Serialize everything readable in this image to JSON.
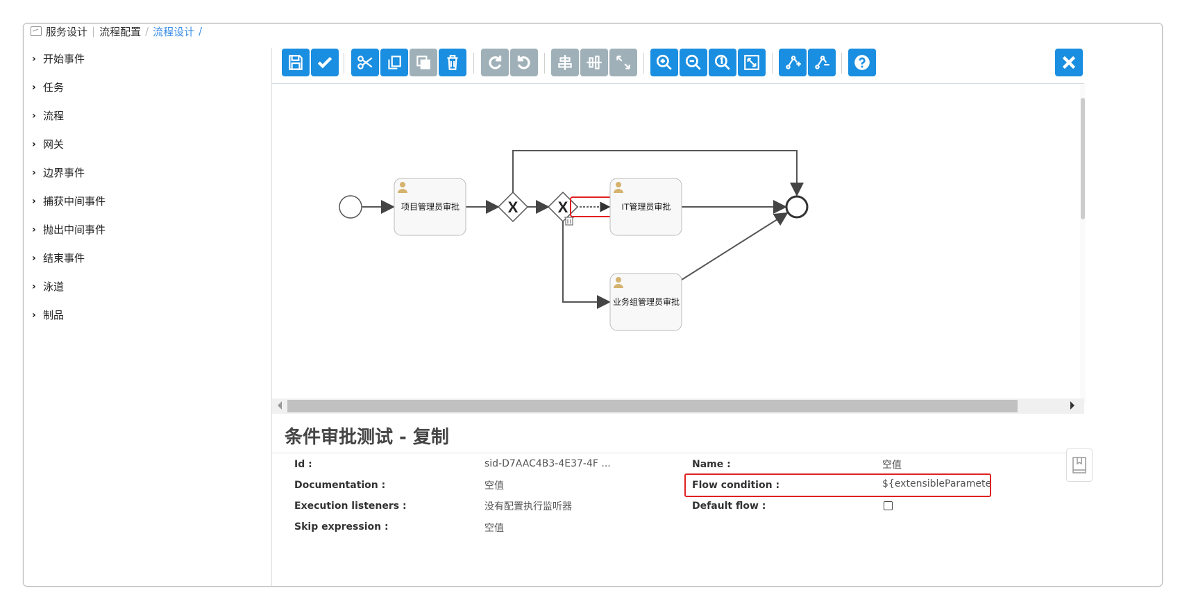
{
  "breadcrumb": {
    "icon": "picture-icon",
    "items": [
      "服务设计",
      "流程配置",
      "流程设计"
    ],
    "separator": "/"
  },
  "palette": {
    "items": [
      "开始事件",
      "任务",
      "流程",
      "网关",
      "边界事件",
      "捕获中间事件",
      "抛出中间事件",
      "结束事件",
      "泳道",
      "制品"
    ]
  },
  "toolbar": {
    "buttons": [
      {
        "name": "save",
        "icon": "save-icon",
        "color": "#1a8ee0"
      },
      {
        "name": "validate",
        "icon": "check-icon",
        "color": "#1a8ee0"
      },
      {
        "name": "cut",
        "icon": "scissors-icon",
        "color": "#1a8ee0"
      },
      {
        "name": "copy",
        "icon": "copy-icon",
        "color": "#1a8ee0"
      },
      {
        "name": "paste",
        "icon": "paste-icon",
        "color": "#9fb0b8"
      },
      {
        "name": "delete",
        "icon": "trash-icon",
        "color": "#1a8ee0"
      },
      {
        "name": "redo",
        "icon": "redo-icon",
        "color": "#9fb0b8"
      },
      {
        "name": "undo",
        "icon": "undo-icon",
        "color": "#9fb0b8"
      },
      {
        "name": "align-horizontal",
        "icon": "align-horizontal-icon",
        "color": "#9fb0b8"
      },
      {
        "name": "align-vertical",
        "icon": "align-vertical-icon",
        "color": "#9fb0b8"
      },
      {
        "name": "same-size",
        "icon": "same-size-icon",
        "color": "#9fb0b8"
      },
      {
        "name": "zoom-in",
        "icon": "zoom-in-icon",
        "color": "#1a8ee0"
      },
      {
        "name": "zoom-out",
        "icon": "zoom-out-icon",
        "color": "#1a8ee0"
      },
      {
        "name": "zoom-actual",
        "icon": "zoom-actual-icon",
        "color": "#1a8ee0"
      },
      {
        "name": "zoom-fit",
        "icon": "zoom-fit-icon",
        "color": "#1a8ee0"
      },
      {
        "name": "add-bendpoint",
        "icon": "add-bendpoint-icon",
        "color": "#1a8ee0"
      },
      {
        "name": "remove-bendpoint",
        "icon": "remove-bendpoint-icon",
        "color": "#1a8ee0"
      },
      {
        "name": "help",
        "icon": "help-icon",
        "color": "#1a8ee0"
      },
      {
        "name": "close",
        "icon": "close-icon",
        "color": "#1a8ee0"
      }
    ]
  },
  "diagram": {
    "tasks": [
      "项目管理员审批",
      "IT管理员审批",
      "业务组管理员审批"
    ],
    "gateway_symbol": "X"
  },
  "properties": {
    "title": "条件审批测试 - 复制",
    "left": [
      {
        "label": "Id :",
        "value": "sid-D7AAC4B3-4E37-4F ..."
      },
      {
        "label": "Documentation :",
        "value": "空值"
      },
      {
        "label": "Execution listeners :",
        "value": "没有配置执行监听器"
      },
      {
        "label": "Skip expression :",
        "value": "空值"
      }
    ],
    "right": [
      {
        "label": "Name :",
        "value": "空值"
      },
      {
        "label": "Flow condition :",
        "value": "${extensibleParamete"
      },
      {
        "label": "Default flow :",
        "value": ""
      }
    ],
    "default_flow_checked": false
  },
  "colors": {
    "accent": "#1a8ee0",
    "disabled": "#9fb0b8",
    "highlight": "#e02020",
    "breadcrumb_active": "#3a8ee6"
  }
}
